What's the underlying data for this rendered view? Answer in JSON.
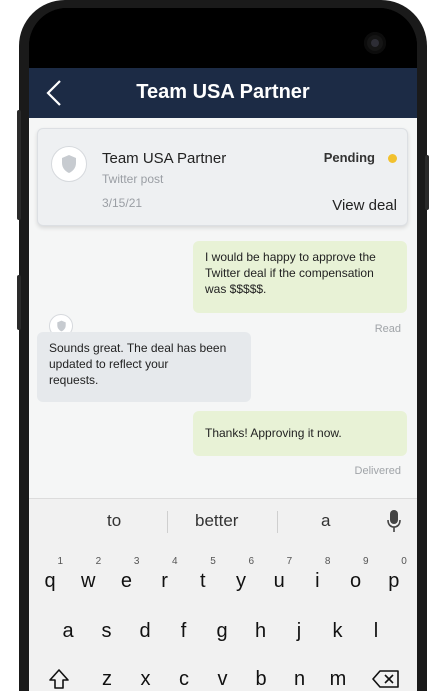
{
  "appbar": {
    "title": "Team USA Partner"
  },
  "deal": {
    "name": "Team USA Partner",
    "type": "Twitter post",
    "date": "3/15/21",
    "status": "Pending",
    "status_color": "#f2c12e",
    "view_label": "View deal"
  },
  "messages": [
    {
      "direction": "out",
      "lines": [
        "I would be happy to approve the",
        "Twitter deal if the compensation",
        "was $$$$$."
      ],
      "status": "Read"
    },
    {
      "direction": "in",
      "lines": [
        "Sounds great. The deal has been",
        "updated to reflect your",
        "requests."
      ]
    },
    {
      "direction": "out",
      "lines": [
        "Thanks! Approving it now."
      ],
      "status": "Delivered"
    }
  ],
  "keyboard": {
    "suggestions": [
      "to",
      "better",
      "a"
    ],
    "row1": [
      {
        "key": "q",
        "num": "1"
      },
      {
        "key": "w",
        "num": "2"
      },
      {
        "key": "e",
        "num": "3"
      },
      {
        "key": "r",
        "num": "4"
      },
      {
        "key": "t",
        "num": "5"
      },
      {
        "key": "y",
        "num": "6"
      },
      {
        "key": "u",
        "num": "7"
      },
      {
        "key": "i",
        "num": "8"
      },
      {
        "key": "o",
        "num": "9"
      },
      {
        "key": "p",
        "num": "0"
      }
    ],
    "row2": [
      "a",
      "s",
      "d",
      "f",
      "g",
      "h",
      "j",
      "k",
      "l"
    ],
    "row3": [
      "z",
      "x",
      "c",
      "v",
      "b",
      "n",
      "m"
    ],
    "icons": {
      "shift": "shift-icon",
      "backspace": "backspace-icon",
      "mic": "microphone-icon"
    }
  },
  "colors": {
    "appbar": "#1c2b45",
    "outgoing": "#e8f2d6",
    "incoming": "#e6e9ec"
  }
}
